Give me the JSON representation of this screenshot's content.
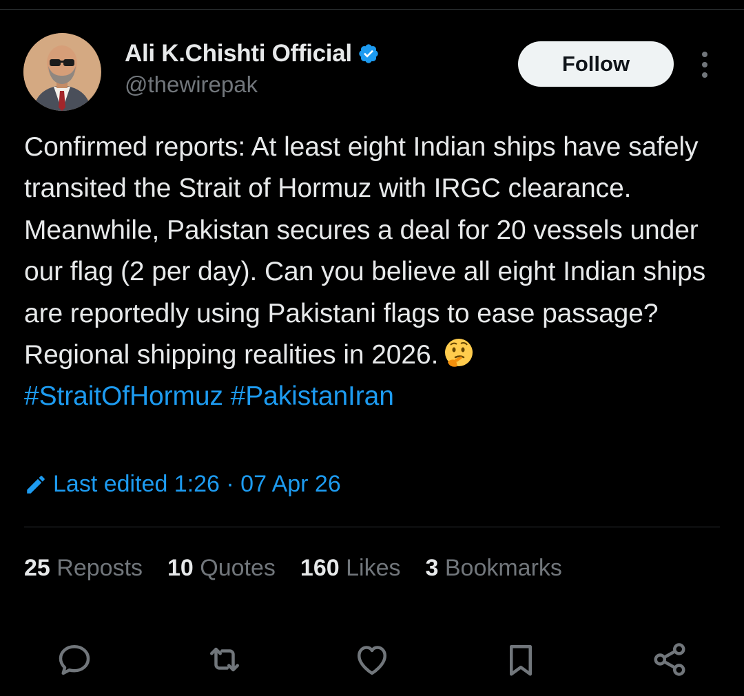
{
  "author": {
    "display_name": "Ali K.Chishti Official",
    "handle": "@thewirepak",
    "verified_icon": "verified-badge-icon",
    "avatar_icon": "avatar"
  },
  "follow_button": {
    "label": "Follow"
  },
  "tweet": {
    "text": "Confirmed reports: At least eight Indian ships have safely transited the Strait of Hormuz with IRGC clearance. Meanwhile, Pakistan secures a deal for 20 vessels under our flag (2 per day). Can you believe all eight Indian ships are reportedly using Pakistani flags to ease passage? Regional shipping realities in 2026.",
    "emoji_icon": "thinking-face-emoji",
    "hashtags": [
      "#StraitOfHormuz",
      "#PakistanIran"
    ]
  },
  "edited": {
    "label": "Last edited 1:26 · 07 Apr 26"
  },
  "stats": {
    "reposts_count": "25",
    "reposts_label": "Reposts",
    "quotes_count": "10",
    "quotes_label": "Quotes",
    "likes_count": "160",
    "likes_label": "Likes",
    "bookmarks_count": "3",
    "bookmarks_label": "Bookmarks"
  },
  "actions": {
    "icons": [
      "reply-icon",
      "repost-icon",
      "like-icon",
      "bookmark-icon",
      "share-icon"
    ]
  },
  "colors": {
    "background": "#000000",
    "text": "#e7e9ea",
    "secondary": "#71767b",
    "accent": "#1d9bf0",
    "divider": "#2f3336",
    "button_bg": "#eff3f4"
  }
}
